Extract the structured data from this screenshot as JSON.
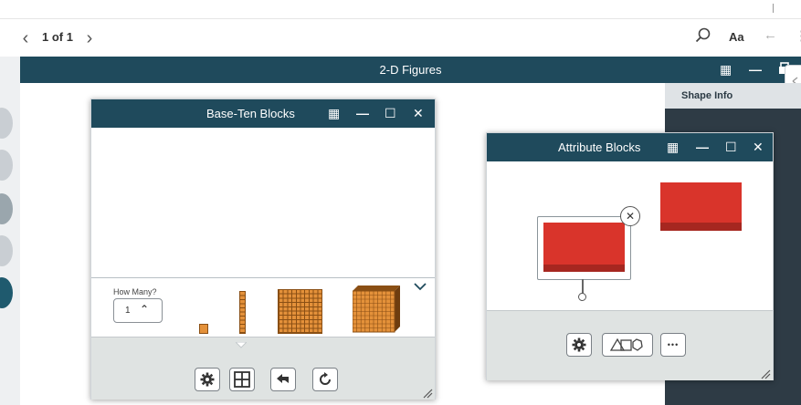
{
  "toolbar": {
    "pager_text": "1 of 1",
    "prev_glyph": "‹",
    "next_glyph": "›",
    "search_glyph": "⌕",
    "text_size_label": "Aa",
    "back_glyph": "←",
    "more_glyph": "⋮"
  },
  "app": {
    "title": "2-D Figures",
    "grid_glyph": "▦",
    "min_glyph": "—",
    "side_panel_title": "Shape Info"
  },
  "base_ten": {
    "title": "Base-Ten Blocks",
    "how_many_label": "How Many?",
    "how_many_value": "1",
    "stepper_up_glyph": "⌃",
    "collapse_glyph": "⌄",
    "window_icons": {
      "grid": "▦",
      "minimize": "—",
      "maximize": "☐",
      "close": "✕"
    },
    "tray_buttons": [
      "settings-icon",
      "grid-layout-icon",
      "undo-icon",
      "reset-icon"
    ],
    "block_color": "#e4913a"
  },
  "attribute": {
    "title": "Attribute Blocks",
    "window_icons": {
      "grid": "▦",
      "minimize": "—",
      "maximize": "☐",
      "close": "✕"
    },
    "tray_buttons": [
      "settings-icon",
      "shapes-icon",
      "more-icon"
    ],
    "more_glyph": "•••",
    "delete_glyph": "✕",
    "shape_color": "#d9342b"
  },
  "colors": {
    "header": "#1f4a5c",
    "tray": "#dfe3e2",
    "panel": "#2e3b45"
  }
}
